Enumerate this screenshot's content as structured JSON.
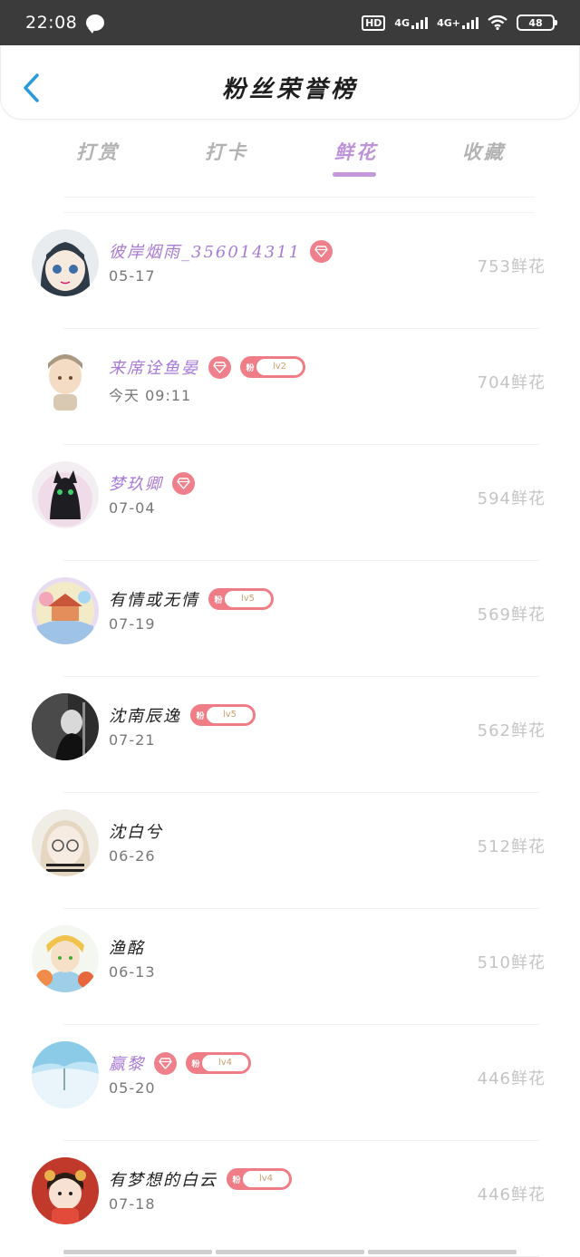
{
  "status_bar": {
    "time": "22:08",
    "hd": "HD",
    "net1": "4G",
    "net2": "4G+",
    "battery": "48"
  },
  "header": {
    "title": "粉丝荣誉榜"
  },
  "tabs": [
    {
      "label": "打赏",
      "active": false
    },
    {
      "label": "打卡",
      "active": false
    },
    {
      "label": "鲜花",
      "active": true
    },
    {
      "label": "收藏",
      "active": false
    }
  ],
  "fans": [
    {
      "name": "彼岸烟雨_356014311",
      "vip": true,
      "gem": true,
      "level": "",
      "date": "05-17",
      "count": "753鲜花"
    },
    {
      "name": "来席诠鱼晏",
      "vip": true,
      "gem": true,
      "level": "lv2",
      "date": "今天  09:11",
      "count": "704鲜花"
    },
    {
      "name": "梦玖卿",
      "vip": true,
      "gem": true,
      "level": "",
      "date": "07-04",
      "count": "594鲜花"
    },
    {
      "name": "有情或无情",
      "vip": false,
      "gem": false,
      "level": "lv5",
      "date": "07-19",
      "count": "569鲜花"
    },
    {
      "name": "沈南辰逸",
      "vip": false,
      "gem": false,
      "level": "lv5",
      "date": "07-21",
      "count": "562鲜花"
    },
    {
      "name": "沈白兮",
      "vip": false,
      "gem": false,
      "level": "",
      "date": "06-26",
      "count": "512鲜花"
    },
    {
      "name": "渔酩",
      "vip": false,
      "gem": false,
      "level": "",
      "date": "06-13",
      "count": "510鲜花"
    },
    {
      "name": "赢黎",
      "vip": true,
      "gem": true,
      "level": "lv4",
      "date": "05-20",
      "count": "446鲜花"
    },
    {
      "name": "有梦想的白云",
      "vip": false,
      "gem": false,
      "level": "lv4",
      "date": "07-18",
      "count": "446鲜花"
    }
  ],
  "fan_badge_char": "粉",
  "colors": {
    "accent": "#bd92d8",
    "vip_name": "#a77ad6",
    "badge": "#ef7f8a",
    "back": "#2a9ad8"
  }
}
